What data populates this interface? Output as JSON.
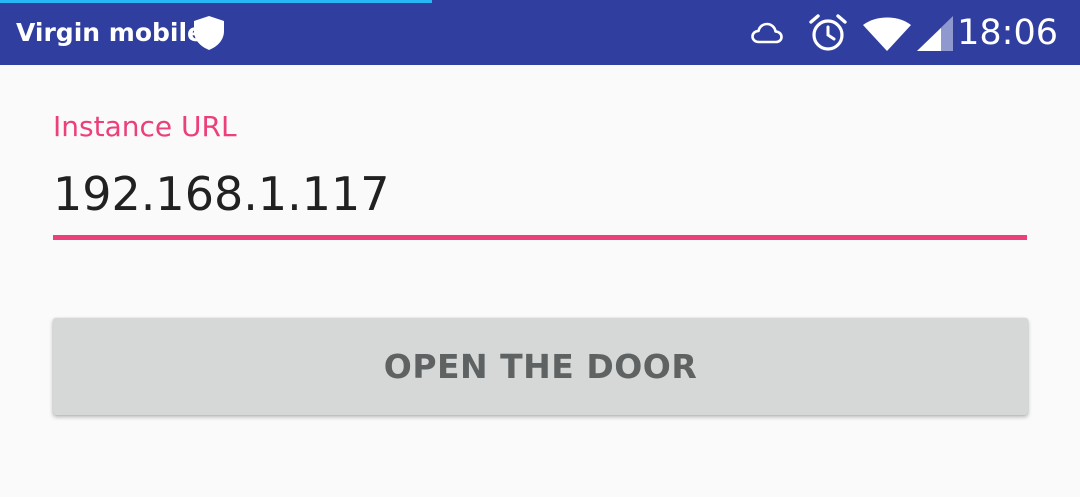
{
  "status_bar": {
    "carrier": "Virgin mobile",
    "time": "18:06",
    "background_color": "#303f9f",
    "loading_progress_fraction": 0.4,
    "icons": [
      "shield-icon",
      "cloud-icon",
      "alarm-clock-icon",
      "wifi-icon",
      "cell-signal-icon"
    ]
  },
  "form": {
    "label": "Instance URL",
    "value": "192.168.1.117",
    "accent_color": "#ec407a"
  },
  "actions": {
    "open_door_label": "OPEN THE DOOR"
  }
}
